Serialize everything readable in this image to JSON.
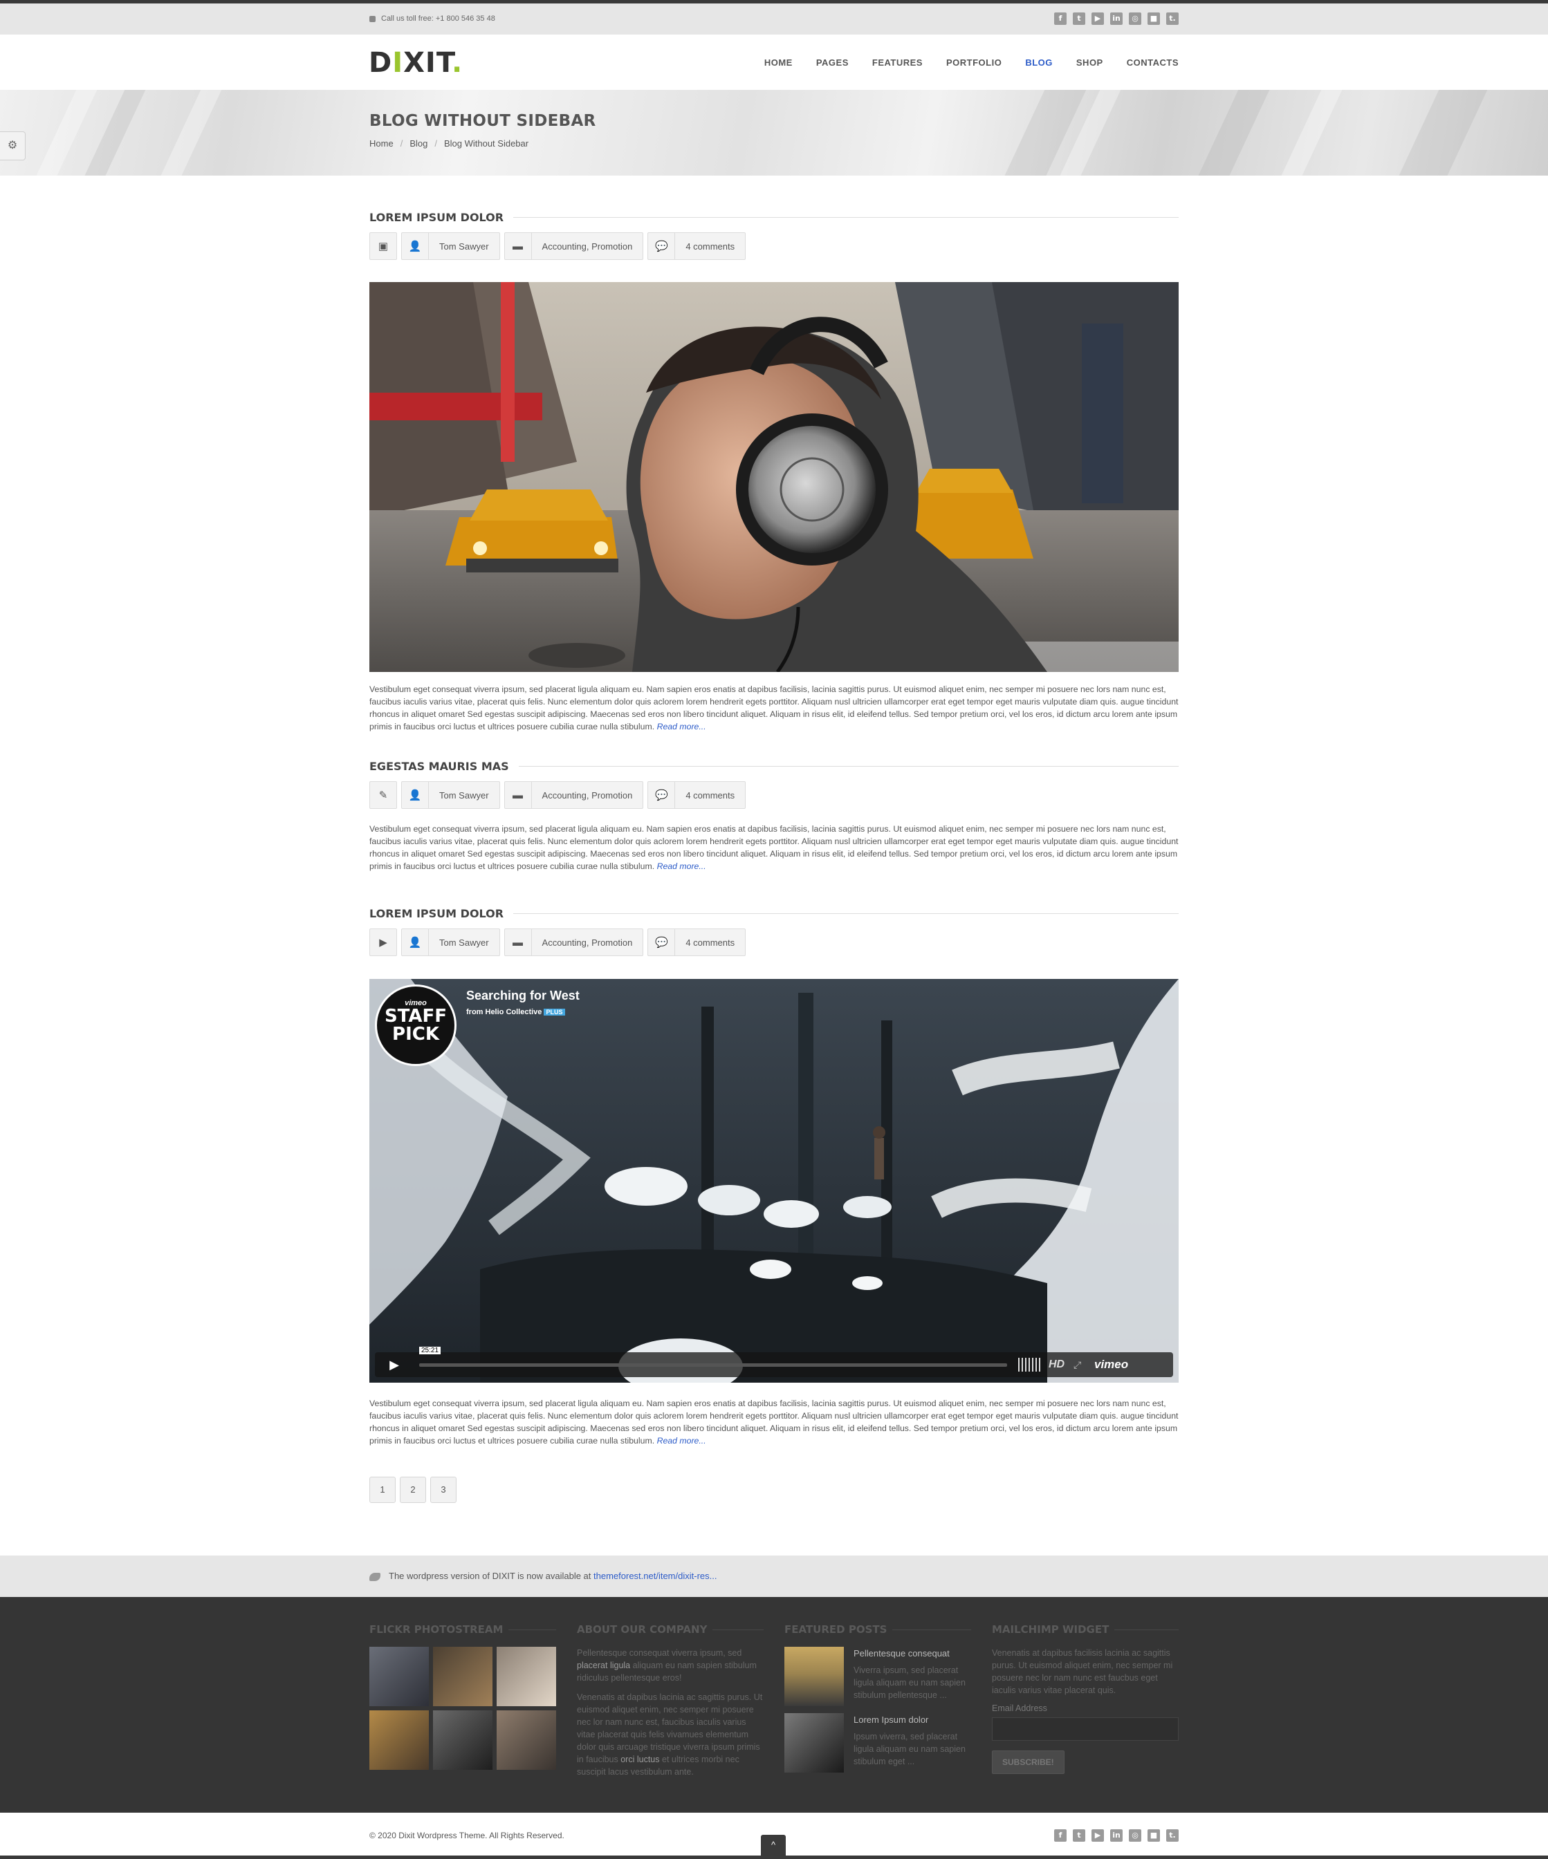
{
  "topbar": {
    "phone": "Call us toll free:  +1 800 546 35 48",
    "social_icons": [
      "facebook-icon",
      "twitter-icon",
      "youtube-icon",
      "linkedin-icon",
      "dribbble-icon",
      "delicious-icon",
      "tumblr-icon"
    ],
    "social_glyphs": [
      "f",
      "t",
      "▶",
      "in",
      "◎",
      "■",
      "t."
    ]
  },
  "header": {
    "logo_pre": "D",
    "logo_i": "I",
    "logo_post": "XIT",
    "logo_dot": ".",
    "nav": [
      "HOME",
      "PAGES",
      "FEATURES",
      "PORTFOLIO",
      "BLOG",
      "SHOP",
      "CONTACTS"
    ],
    "nav_active": "BLOG"
  },
  "banner": {
    "title": "BLOG WITHOUT SIDEBAR",
    "breadcrumbs": [
      "Home",
      "Blog",
      "Blog Without Sidebar"
    ]
  },
  "posts": [
    {
      "title": "LOREM IPSUM DOLOR",
      "type_icon": "image-icon",
      "author": "Tom Sawyer",
      "categories": "Accounting, Promotion",
      "comments": "4 comments",
      "excerpt": "Vestibulum eget consequat viverra ipsum, sed placerat ligula aliquam eu. Nam sapien eros enatis at dapibus facilisis, lacinia sagittis purus. Ut euismod aliquet enim, nec semper mi posuere nec lors nam nunc est, faucibus iaculis varius vitae, placerat quis felis. Nunc elementum dolor quis aclorem lorem hendrerit egets porttitor. Aliquam nusl ultricien ullamcorper erat eget tempor eget mauris vulputate diam quis. augue tincidunt rhoncus in aliquet omaret Sed egestas suscipit adipiscing. Maecenas sed eros non libero tincidunt aliquet. Aliquam in risus elit, id eleifend tellus. Sed tempor pretium orci, vel los eros, id dictum arcu lorem ante ipsum primis in faucibus orci luctus et ultrices posuere cubilia curae nulla stibulum.",
      "read_more": "Read more..."
    },
    {
      "title": "EGESTAS MAURIS MAS",
      "type_icon": "pencil-icon",
      "author": "Tom Sawyer",
      "categories": "Accounting, Promotion",
      "comments": "4 comments",
      "excerpt": "Vestibulum eget consequat viverra ipsum, sed placerat ligula aliquam eu. Nam sapien eros enatis at dapibus facilisis, lacinia sagittis purus. Ut euismod aliquet enim, nec semper mi posuere nec lors nam nunc est, faucibus iaculis varius vitae, placerat quis felis. Nunc elementum dolor quis aclorem lorem hendrerit egets porttitor. Aliquam nusl ultricien ullamcorper erat eget tempor eget mauris vulputate diam quis. augue tincidunt rhoncus in aliquet omaret Sed egestas suscipit adipiscing. Maecenas sed eros non libero tincidunt aliquet. Aliquam in risus elit, id eleifend tellus. Sed tempor pretium orci, vel los eros, id dictum arcu lorem ante ipsum primis in faucibus orci luctus et ultrices posuere cubilia curae nulla stibulum.",
      "read_more": "Read more..."
    },
    {
      "title": "LOREM IPSUM DOLOR",
      "type_icon": "play-icon",
      "author": "Tom Sawyer",
      "categories": "Accounting, Promotion",
      "comments": "4 comments",
      "excerpt": "Vestibulum eget consequat viverra ipsum, sed placerat ligula aliquam eu. Nam sapien eros enatis at dapibus facilisis, lacinia sagittis purus. Ut euismod aliquet enim, nec semper mi posuere nec lors nam nunc est, faucibus iaculis varius vitae, placerat quis felis. Nunc elementum dolor quis aclorem lorem hendrerit egets porttitor. Aliquam nusl ultricien ullamcorper erat eget tempor eget mauris vulputate diam quis. augue tincidunt rhoncus in aliquet omaret Sed egestas suscipit adipiscing. Maecenas sed eros non libero tincidunt aliquet. Aliquam in risus elit, id eleifend tellus. Sed tempor pretium orci, vel los eros, id dictum arcu lorem ante ipsum primis in faucibus orci luctus et ultrices posuere cubilia curae nulla stibulum.",
      "read_more": "Read more..."
    }
  ],
  "video": {
    "title": "Searching for West",
    "byline": "from Helio Collective",
    "plus_badge": "PLUS",
    "badge_top": "vimeo",
    "badge_line1": "STAFF",
    "badge_line2": "PICK",
    "duration": "25:21",
    "hd": "HD",
    "brand": "vimeo"
  },
  "pagination": [
    "1",
    "2",
    "3"
  ],
  "notice": {
    "text": "The wordpress version of DIXIT is now available at ",
    "link": "themeforest.net/item/dixit-res..."
  },
  "footer": {
    "flickr_title": "FLICKR PHOTOSTREAM",
    "about_title": "ABOUT OUR COMPANY",
    "about_p1_a": "Pellentesque consequat viverra ipsum, sed ",
    "about_p1_b": "placerat ligula",
    "about_p1_c": " aliquam eu nam sapien stibulum ridiculus pellentesque eros!",
    "about_p2_a": "Venenatis at dapibus lacinia ac sagittis purus. Ut euismod aliquet enim, nec semper mi posuere nec lor nam nunc est, faucibus iaculis varius vitae placerat quis felis vivamues elementum dolor quis arcuage tristique viverra ipsum primis in faucibus ",
    "about_p2_b": "orci luctus",
    "about_p2_c": " et ultrices morbi nec suscipit lacus vestibulum ante.",
    "featured_title": "FEATURED POSTS",
    "featured": [
      {
        "title": "Pellentesque consequat",
        "body": "Viverra ipsum, sed placerat ligula aliquam eu nam sapien stibulum pellentesque ..."
      },
      {
        "title": "Lorem Ipsum dolor",
        "body": "Ipsum viverra, sed placerat ligula aliquam eu nam sapien stibulum eget ..."
      }
    ],
    "mailchimp_title": "MAILCHIMP WIDGET",
    "mailchimp_text": "Venenatis at dapibus facilisis lacinia ac sagittis purus. Ut euismod aliquet enim, nec semper mi posuere nec lor nam nunc est faucbus eget iaculis varius vitae placerat quis.",
    "email_label": "Email Address",
    "subscribe": "SUBSCRIBE!"
  },
  "bottom": {
    "copyright": "© 2020 Dixit Wordpress Theme. All Rights Reserved.",
    "to_top": "^"
  },
  "colors": {
    "accent_blue": "#2d5cc8",
    "logo_green": "#9ac52e",
    "footer_bg": "#353535"
  }
}
